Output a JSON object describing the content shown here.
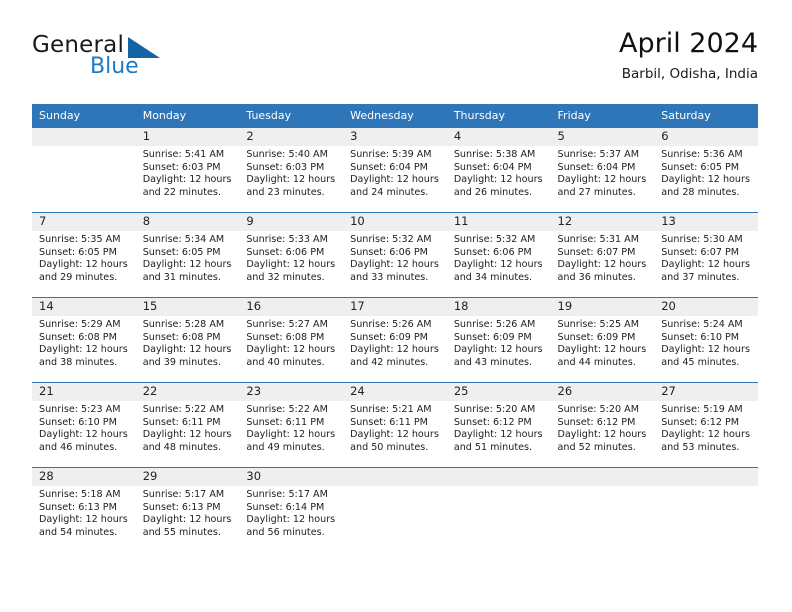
{
  "brand": {
    "name_part1": "General",
    "name_part2": "Blue",
    "logo_icon": "triangle-icon"
  },
  "header": {
    "title": "April 2024",
    "location": "Barbil, Odisha, India"
  },
  "colors": {
    "header_blue": "#2e76b8",
    "brand_blue": "#1f7ac4",
    "logo_blue": "#1464a5",
    "daynum_band": "#efefef"
  },
  "calendar": {
    "weekday_headers": [
      "Sunday",
      "Monday",
      "Tuesday",
      "Wednesday",
      "Thursday",
      "Friday",
      "Saturday"
    ],
    "weeks": [
      [
        {
          "day": "",
          "sunrise": "",
          "sunset": "",
          "daylight_line1": "",
          "daylight_line2": ""
        },
        {
          "day": "1",
          "sunrise": "Sunrise: 5:41 AM",
          "sunset": "Sunset: 6:03 PM",
          "daylight_line1": "Daylight: 12 hours",
          "daylight_line2": "and 22 minutes."
        },
        {
          "day": "2",
          "sunrise": "Sunrise: 5:40 AM",
          "sunset": "Sunset: 6:03 PM",
          "daylight_line1": "Daylight: 12 hours",
          "daylight_line2": "and 23 minutes."
        },
        {
          "day": "3",
          "sunrise": "Sunrise: 5:39 AM",
          "sunset": "Sunset: 6:04 PM",
          "daylight_line1": "Daylight: 12 hours",
          "daylight_line2": "and 24 minutes."
        },
        {
          "day": "4",
          "sunrise": "Sunrise: 5:38 AM",
          "sunset": "Sunset: 6:04 PM",
          "daylight_line1": "Daylight: 12 hours",
          "daylight_line2": "and 26 minutes."
        },
        {
          "day": "5",
          "sunrise": "Sunrise: 5:37 AM",
          "sunset": "Sunset: 6:04 PM",
          "daylight_line1": "Daylight: 12 hours",
          "daylight_line2": "and 27 minutes."
        },
        {
          "day": "6",
          "sunrise": "Sunrise: 5:36 AM",
          "sunset": "Sunset: 6:05 PM",
          "daylight_line1": "Daylight: 12 hours",
          "daylight_line2": "and 28 minutes."
        }
      ],
      [
        {
          "day": "7",
          "sunrise": "Sunrise: 5:35 AM",
          "sunset": "Sunset: 6:05 PM",
          "daylight_line1": "Daylight: 12 hours",
          "daylight_line2": "and 29 minutes."
        },
        {
          "day": "8",
          "sunrise": "Sunrise: 5:34 AM",
          "sunset": "Sunset: 6:05 PM",
          "daylight_line1": "Daylight: 12 hours",
          "daylight_line2": "and 31 minutes."
        },
        {
          "day": "9",
          "sunrise": "Sunrise: 5:33 AM",
          "sunset": "Sunset: 6:06 PM",
          "daylight_line1": "Daylight: 12 hours",
          "daylight_line2": "and 32 minutes."
        },
        {
          "day": "10",
          "sunrise": "Sunrise: 5:32 AM",
          "sunset": "Sunset: 6:06 PM",
          "daylight_line1": "Daylight: 12 hours",
          "daylight_line2": "and 33 minutes."
        },
        {
          "day": "11",
          "sunrise": "Sunrise: 5:32 AM",
          "sunset": "Sunset: 6:06 PM",
          "daylight_line1": "Daylight: 12 hours",
          "daylight_line2": "and 34 minutes."
        },
        {
          "day": "12",
          "sunrise": "Sunrise: 5:31 AM",
          "sunset": "Sunset: 6:07 PM",
          "daylight_line1": "Daylight: 12 hours",
          "daylight_line2": "and 36 minutes."
        },
        {
          "day": "13",
          "sunrise": "Sunrise: 5:30 AM",
          "sunset": "Sunset: 6:07 PM",
          "daylight_line1": "Daylight: 12 hours",
          "daylight_line2": "and 37 minutes."
        }
      ],
      [
        {
          "day": "14",
          "sunrise": "Sunrise: 5:29 AM",
          "sunset": "Sunset: 6:08 PM",
          "daylight_line1": "Daylight: 12 hours",
          "daylight_line2": "and 38 minutes."
        },
        {
          "day": "15",
          "sunrise": "Sunrise: 5:28 AM",
          "sunset": "Sunset: 6:08 PM",
          "daylight_line1": "Daylight: 12 hours",
          "daylight_line2": "and 39 minutes."
        },
        {
          "day": "16",
          "sunrise": "Sunrise: 5:27 AM",
          "sunset": "Sunset: 6:08 PM",
          "daylight_line1": "Daylight: 12 hours",
          "daylight_line2": "and 40 minutes."
        },
        {
          "day": "17",
          "sunrise": "Sunrise: 5:26 AM",
          "sunset": "Sunset: 6:09 PM",
          "daylight_line1": "Daylight: 12 hours",
          "daylight_line2": "and 42 minutes."
        },
        {
          "day": "18",
          "sunrise": "Sunrise: 5:26 AM",
          "sunset": "Sunset: 6:09 PM",
          "daylight_line1": "Daylight: 12 hours",
          "daylight_line2": "and 43 minutes."
        },
        {
          "day": "19",
          "sunrise": "Sunrise: 5:25 AM",
          "sunset": "Sunset: 6:09 PM",
          "daylight_line1": "Daylight: 12 hours",
          "daylight_line2": "and 44 minutes."
        },
        {
          "day": "20",
          "sunrise": "Sunrise: 5:24 AM",
          "sunset": "Sunset: 6:10 PM",
          "daylight_line1": "Daylight: 12 hours",
          "daylight_line2": "and 45 minutes."
        }
      ],
      [
        {
          "day": "21",
          "sunrise": "Sunrise: 5:23 AM",
          "sunset": "Sunset: 6:10 PM",
          "daylight_line1": "Daylight: 12 hours",
          "daylight_line2": "and 46 minutes."
        },
        {
          "day": "22",
          "sunrise": "Sunrise: 5:22 AM",
          "sunset": "Sunset: 6:11 PM",
          "daylight_line1": "Daylight: 12 hours",
          "daylight_line2": "and 48 minutes."
        },
        {
          "day": "23",
          "sunrise": "Sunrise: 5:22 AM",
          "sunset": "Sunset: 6:11 PM",
          "daylight_line1": "Daylight: 12 hours",
          "daylight_line2": "and 49 minutes."
        },
        {
          "day": "24",
          "sunrise": "Sunrise: 5:21 AM",
          "sunset": "Sunset: 6:11 PM",
          "daylight_line1": "Daylight: 12 hours",
          "daylight_line2": "and 50 minutes."
        },
        {
          "day": "25",
          "sunrise": "Sunrise: 5:20 AM",
          "sunset": "Sunset: 6:12 PM",
          "daylight_line1": "Daylight: 12 hours",
          "daylight_line2": "and 51 minutes."
        },
        {
          "day": "26",
          "sunrise": "Sunrise: 5:20 AM",
          "sunset": "Sunset: 6:12 PM",
          "daylight_line1": "Daylight: 12 hours",
          "daylight_line2": "and 52 minutes."
        },
        {
          "day": "27",
          "sunrise": "Sunrise: 5:19 AM",
          "sunset": "Sunset: 6:12 PM",
          "daylight_line1": "Daylight: 12 hours",
          "daylight_line2": "and 53 minutes."
        }
      ],
      [
        {
          "day": "28",
          "sunrise": "Sunrise: 5:18 AM",
          "sunset": "Sunset: 6:13 PM",
          "daylight_line1": "Daylight: 12 hours",
          "daylight_line2": "and 54 minutes."
        },
        {
          "day": "29",
          "sunrise": "Sunrise: 5:17 AM",
          "sunset": "Sunset: 6:13 PM",
          "daylight_line1": "Daylight: 12 hours",
          "daylight_line2": "and 55 minutes."
        },
        {
          "day": "30",
          "sunrise": "Sunrise: 5:17 AM",
          "sunset": "Sunset: 6:14 PM",
          "daylight_line1": "Daylight: 12 hours",
          "daylight_line2": "and 56 minutes."
        },
        {
          "day": "",
          "sunrise": "",
          "sunset": "",
          "daylight_line1": "",
          "daylight_line2": ""
        },
        {
          "day": "",
          "sunrise": "",
          "sunset": "",
          "daylight_line1": "",
          "daylight_line2": ""
        },
        {
          "day": "",
          "sunrise": "",
          "sunset": "",
          "daylight_line1": "",
          "daylight_line2": ""
        },
        {
          "day": "",
          "sunrise": "",
          "sunset": "",
          "daylight_line1": "",
          "daylight_line2": ""
        }
      ]
    ]
  }
}
